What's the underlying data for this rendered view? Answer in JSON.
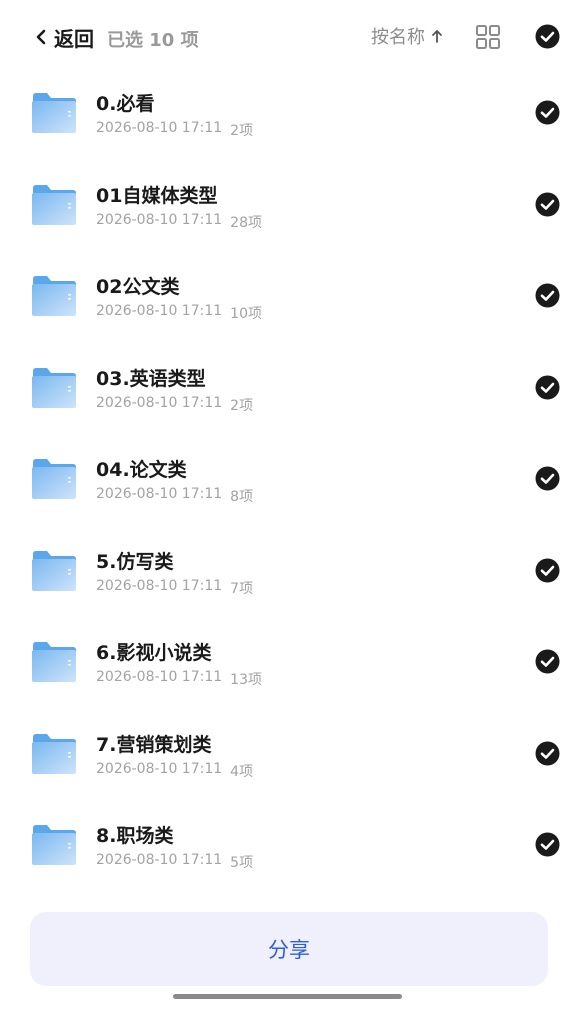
{
  "header": {
    "back_label": "返回",
    "selected_text": "已选 10 项",
    "sort_label": "按名称",
    "sort_direction": "ascending",
    "view_toggle_icon": "grid-view-icon",
    "select_all_checked": true
  },
  "files": [
    {
      "name": "0.必看",
      "date": "2026-08-10 17:11",
      "count": "2项",
      "checked": true
    },
    {
      "name": "01自媒体类型",
      "date": "2026-08-10 17:11",
      "count": "28项",
      "checked": true
    },
    {
      "name": "02公文类",
      "date": "2026-08-10 17:11",
      "count": "10项",
      "checked": true
    },
    {
      "name": "03.英语类型",
      "date": "2026-08-10 17:11",
      "count": "2项",
      "checked": true
    },
    {
      "name": "04.论文类",
      "date": "2026-08-10 17:11",
      "count": "8项",
      "checked": true
    },
    {
      "name": "5.仿写类",
      "date": "2026-08-10 17:11",
      "count": "7项",
      "checked": true
    },
    {
      "name": "6.影视小说类",
      "date": "2026-08-10 17:11",
      "count": "13项",
      "checked": true
    },
    {
      "name": "7.营销策划类",
      "date": "2026-08-10 17:11",
      "count": "4项",
      "checked": true
    },
    {
      "name": "8.职场类",
      "date": "2026-08-10 17:11",
      "count": "5项",
      "checked": true
    }
  ],
  "footer": {
    "share_label": "分享"
  },
  "colors": {
    "accent": "#2f5fd6",
    "folder_light": "#cfe3fb",
    "folder_dark": "#5aa7ec",
    "check_bg": "#1a1a1a",
    "share_bg": "#eff0fb"
  }
}
